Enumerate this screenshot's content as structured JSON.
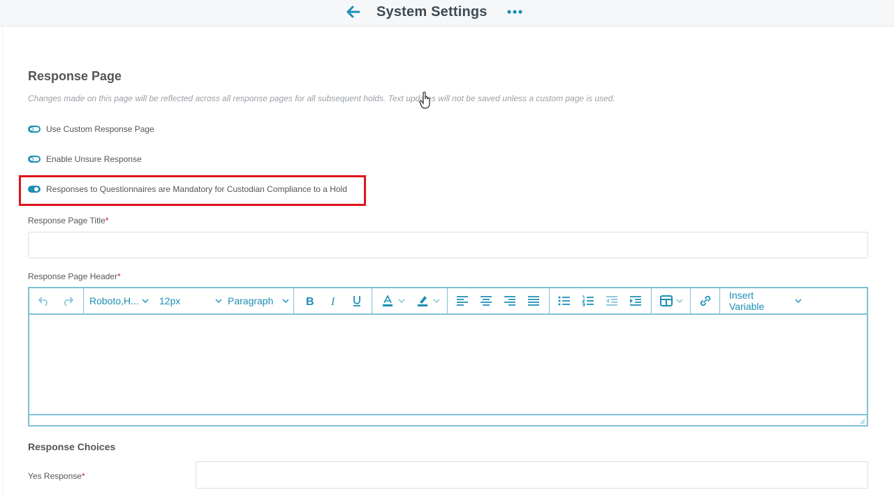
{
  "header": {
    "title": "System Settings"
  },
  "section": {
    "title": "Response Page",
    "description": "Changes made on this page will be reflected across all response pages for all subsequent holds. Text updates will not be saved unless a custom page is used."
  },
  "toggles": [
    {
      "label": "Use Custom Response Page",
      "state": "off"
    },
    {
      "label": "Enable Unsure Response",
      "state": "off"
    },
    {
      "label": "Responses to Questionnaires are Mandatory for Custodian Compliance to a Hold",
      "state": "on"
    }
  ],
  "fields": {
    "title_label": "Response Page Title",
    "title_value": "",
    "header_label": "Response Page Header",
    "required_marker": "*"
  },
  "editor": {
    "font_family": "Roboto,H...",
    "font_size": "12px",
    "block_format": "Paragraph",
    "insert_variable": "Insert Variable",
    "accent_color": "#1b8fb5"
  },
  "choices": {
    "title": "Response Choices",
    "yes_label": "Yes Response",
    "yes_value": ""
  },
  "colors": {
    "highlight": "#e0141b",
    "accent": "#1b8fb5"
  }
}
